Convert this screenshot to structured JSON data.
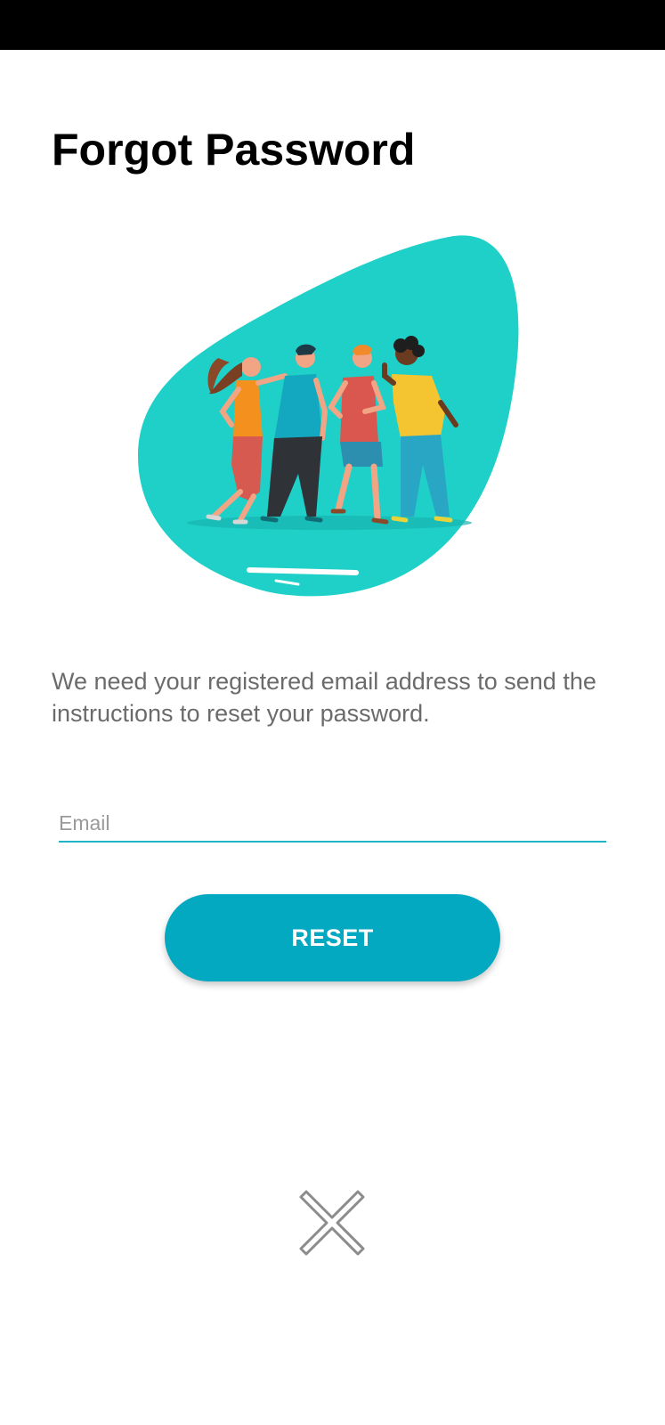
{
  "title": "Forgot Password",
  "description": "We need your registered email address to send the instructions to reset your password.",
  "email": {
    "placeholder": "Email",
    "value": ""
  },
  "reset_button": {
    "label": "RESET"
  },
  "close_button": {
    "icon": "close-icon"
  },
  "colors": {
    "accent": "#03a8c1",
    "blob": "#1ed0c8",
    "field_underline": "#1fb5c6",
    "title": "#000000",
    "description": "#6b6b6b"
  }
}
